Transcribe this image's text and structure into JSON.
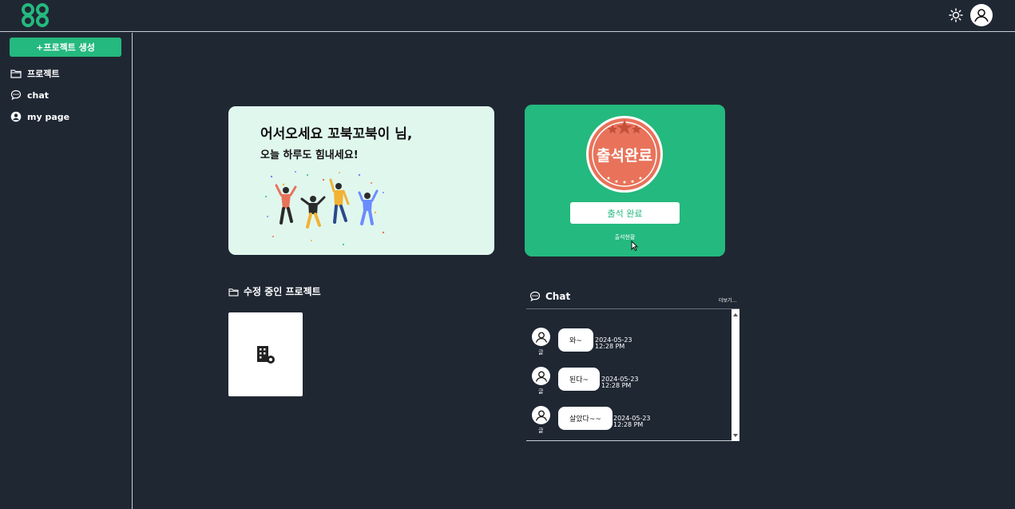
{
  "header": {
    "logo_icon": "infinity-logo-icon",
    "theme_icon": "sun-icon",
    "profile_icon": "user-avatar-icon"
  },
  "sidebar": {
    "create_button": "+프로젝트 생성",
    "items": [
      {
        "label": "프로젝트",
        "icon": "folder-icon"
      },
      {
        "label": "chat",
        "icon": "chat-bubble-icon"
      },
      {
        "label": "my page",
        "icon": "user-circle-icon"
      }
    ]
  },
  "welcome": {
    "title": "어서오세요 꼬북꼬북이 님,",
    "subtitle": "오늘 하루도 힘내세요!"
  },
  "attendance": {
    "stamp_text": "출석완료",
    "button_label": "출석 완료",
    "status_link": "출석현황"
  },
  "projects": {
    "heading": "수정 중인 프로젝트"
  },
  "chat": {
    "heading": "Chat",
    "more_link": "더보기...",
    "messages": [
      {
        "user": "글",
        "text": "와~",
        "date": "2024-05-23",
        "time": "12:28 PM"
      },
      {
        "user": "글",
        "text": "된다~",
        "date": "2024-05-23",
        "time": "12:28 PM"
      },
      {
        "user": "글",
        "text": "살았다~~",
        "date": "2024-05-23",
        "time": "12:28 PM"
      }
    ]
  },
  "colors": {
    "background": "#1f2733",
    "accent": "#24b97e",
    "welcome_bg": "#e0f7ee",
    "stamp": "#e8735a"
  }
}
